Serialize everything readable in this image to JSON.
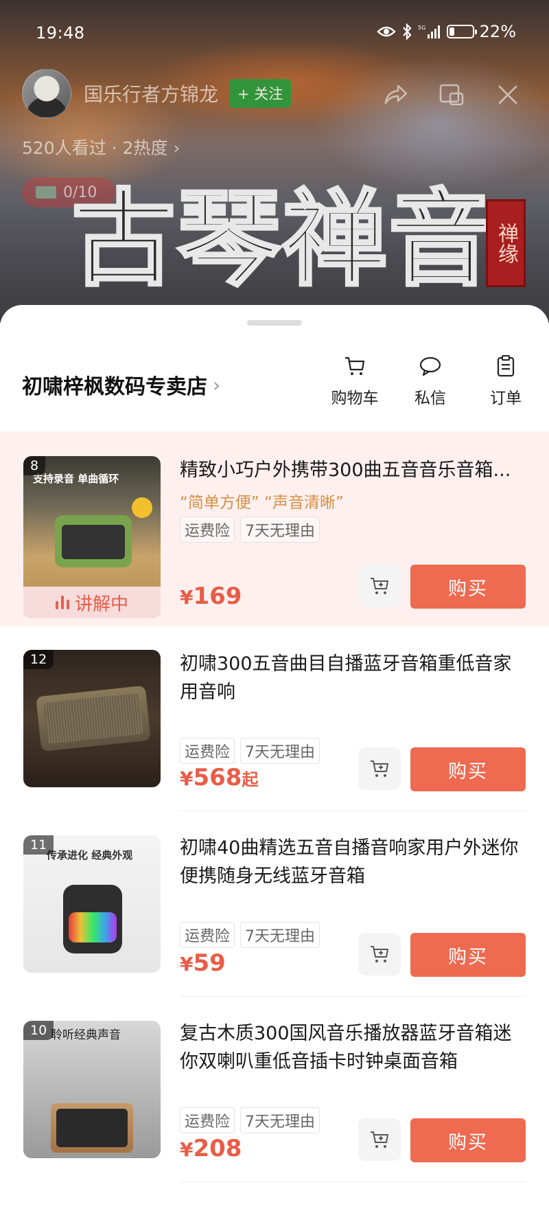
{
  "status_bar": {
    "time": "19:48",
    "battery_pct": "22%",
    "battery_level": 0.22
  },
  "host": {
    "name": "国乐行者方锦龙",
    "follow_label": "+ 关注"
  },
  "viewers": {
    "text": "520人看过 · 2热度 ›"
  },
  "badge": {
    "text": "0/10"
  },
  "banner": {
    "title": "古琴禅音",
    "seal_text": "禅缘"
  },
  "shop": {
    "name": "初啸梓枫数码专卖店",
    "actions": [
      {
        "label": "购物车",
        "icon": "cart-icon"
      },
      {
        "label": "私信",
        "icon": "message-icon"
      },
      {
        "label": "订单",
        "icon": "order-icon"
      }
    ]
  },
  "products": [
    {
      "rank": "8",
      "title": "精致小巧户外携带300曲五音音乐音箱...",
      "slogan": "“简单方便” “声音清晰”",
      "tags": [
        "运费险",
        "7天无理由"
      ],
      "yen": "¥",
      "price": "169",
      "price_suffix": "",
      "live_label": "讲解中",
      "buy_label": "购买",
      "thumb_text": "支持录音  单曲循环"
    },
    {
      "rank": "12",
      "title": "初啸300五音曲目自播蓝牙音箱重低音家用音响",
      "tags": [
        "运费险",
        "7天无理由"
      ],
      "yen": "¥",
      "price": "568",
      "price_suffix": "起",
      "buy_label": "购买"
    },
    {
      "rank": "11",
      "title": "初啸40曲精选五音自播音响家用户外迷你便携随身无线蓝牙音箱",
      "tags": [
        "运费险",
        "7天无理由"
      ],
      "yen": "¥",
      "price": "59",
      "price_suffix": "",
      "buy_label": "购买",
      "thumb_text": "传承进化 经典外观"
    },
    {
      "rank": "10",
      "title": "复古木质300国风音乐播放器蓝牙音箱迷你双喇叭重低音插卡时钟桌面音箱",
      "tags": [
        "运费险",
        "7天无理由"
      ],
      "yen": "¥",
      "price": "208",
      "price_suffix": "",
      "buy_label": "购买",
      "thumb_text": "聆听经典声音"
    }
  ],
  "colors": {
    "accent": "#ee6a50",
    "price": "#e85d48",
    "active_bg": "#fdf0ef",
    "follow_green": "#1e9e3c"
  }
}
